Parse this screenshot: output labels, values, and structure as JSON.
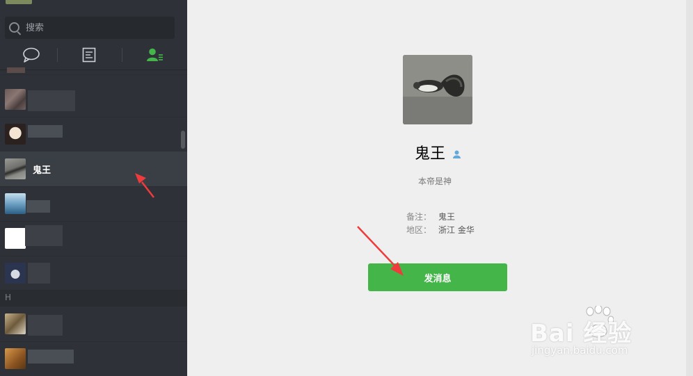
{
  "search": {
    "placeholder": "搜索"
  },
  "tabs": [
    {
      "name": "chat",
      "icon": "chat-bubble-icon",
      "active": false
    },
    {
      "name": "articles",
      "icon": "document-icon",
      "active": false
    },
    {
      "name": "contacts",
      "icon": "contacts-icon",
      "active": true
    }
  ],
  "contacts": {
    "selected_name": "鬼王",
    "section_header": "H"
  },
  "profile": {
    "name": "鬼王",
    "signature": "本帝是神",
    "remark_label": "备注：",
    "remark_value": "鬼王",
    "region_label": "地区：",
    "region_value": "浙江  金华",
    "send_button": "发消息"
  },
  "watermark": {
    "logo": "Bai  经验",
    "url": "jingyan.baidu.com"
  },
  "colors": {
    "sidebar_bg": "#2e3238",
    "main_bg": "#efefef",
    "send_button": "#44b549",
    "arrow": "#ef3b3b"
  }
}
